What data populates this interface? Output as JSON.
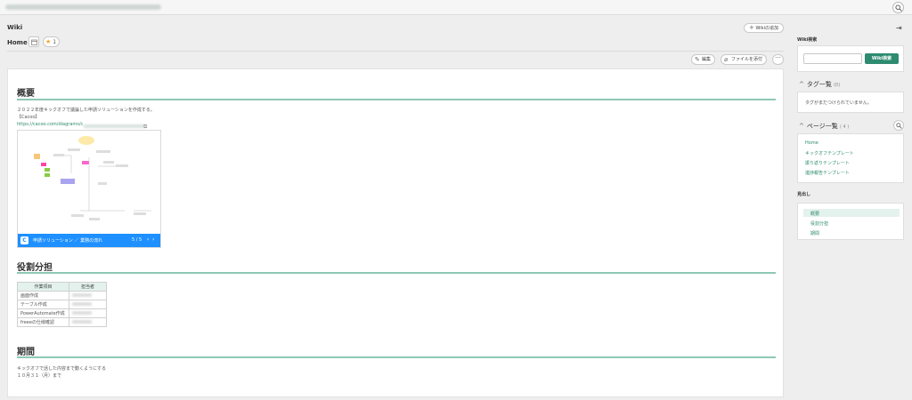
{
  "header": {
    "title": "Wiki",
    "page_name": "Home",
    "star_count": "1",
    "add_wiki_label": "Wikiの追加"
  },
  "toolbar": {
    "edit_label": "編集",
    "attach_label": "ファイルを添付",
    "more_label": "···"
  },
  "content": {
    "section1": {
      "heading": "概要",
      "line1": "２０２２年度キックオフで議論した申請ソリューションを作成する。",
      "line2": "【Cacoo】",
      "link": "https://cacoo.com/diagrams/c",
      "diagram_label": "申請ソリューション ／ 業務の流れ",
      "diagram_pager": "5 / 5",
      "diagram_logo": "C"
    },
    "section2": {
      "heading": "役割分担",
      "table": {
        "headers": [
          "作業項目",
          "担当者"
        ],
        "rows": [
          [
            "画面作成"
          ],
          [
            "テーブル作成"
          ],
          [
            "PowerAutomate作成"
          ],
          [
            "freeeの仕様確認"
          ]
        ]
      }
    },
    "section3": {
      "heading": "期間",
      "line1": "キックオフで話した内容まで動くようにする",
      "line2": "１０月３１（月）まで"
    }
  },
  "sidebar": {
    "search_label": "Wiki検索",
    "search_placeholder": "",
    "search_button": "Wiki検索",
    "tags": {
      "title": "タグ一覧",
      "count": "(0)",
      "empty_text": "タグがまだつけられていません。"
    },
    "pages": {
      "title": "ページ一覧",
      "count": "( 4 )",
      "items": [
        "Home",
        "キックオフテンプレート",
        "振り返りテンプレート",
        "進捗報告テンプレート"
      ]
    },
    "toc": {
      "title": "見出し",
      "items": [
        "概要",
        "役割分担",
        "期間"
      ]
    }
  },
  "colors": {
    "accent": "#2e8b6f",
    "rule": "#8fc8b4",
    "cacoo_bar": "#1e90ff"
  }
}
